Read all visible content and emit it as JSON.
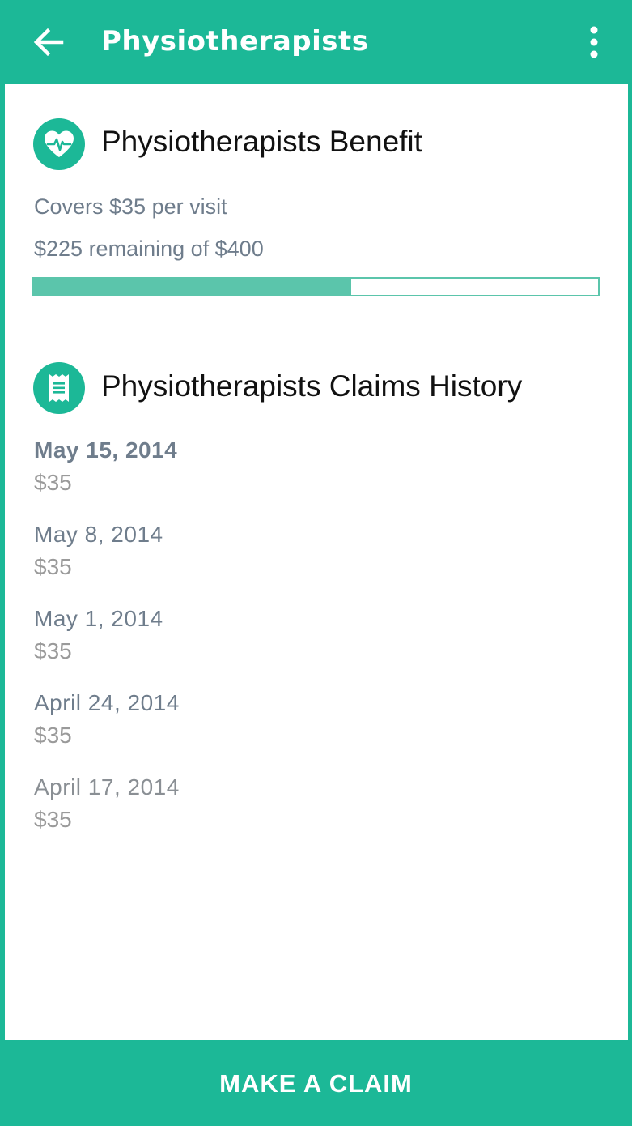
{
  "appbar": {
    "title": "Physiotherapists",
    "back_icon": "arrow-left-icon",
    "menu_icon": "more-vertical-icon"
  },
  "benefit": {
    "icon": "heart-pulse-icon",
    "title": "Physiotherapists Benefit",
    "coverage": "Covers $35 per visit",
    "remaining_text": "$225 remaining of $400",
    "remaining_fraction": 0.5625
  },
  "history": {
    "icon": "receipt-icon",
    "title": "Physiotherapists Claims History",
    "claims": [
      {
        "date": "May 15, 2014",
        "amount": "$35"
      },
      {
        "date": "May 8, 2014",
        "amount": "$35"
      },
      {
        "date": "May 1, 2014",
        "amount": "$35"
      },
      {
        "date": "April 24, 2014",
        "amount": "$35"
      },
      {
        "date": "April 17, 2014",
        "amount": "$35"
      }
    ]
  },
  "action": {
    "label": "MAKE A CLAIM"
  },
  "colors": {
    "accent": "#1cb897",
    "progress": "#5bc5ab",
    "muted_text": "#6f7d8c"
  }
}
